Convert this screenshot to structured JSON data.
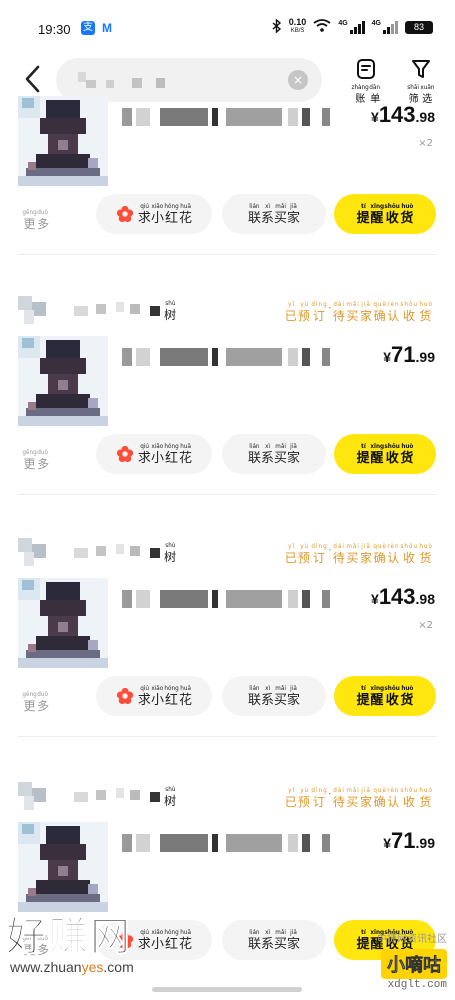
{
  "status_bar": {
    "time": "19:30",
    "net_speed": "0.10",
    "net_unit": "KB/S",
    "sig1": "4G",
    "sig2": "4G",
    "battery": "83"
  },
  "header": {
    "bill_py": [
      "zhàng",
      "dān"
    ],
    "bill_chars": [
      "账",
      "单"
    ],
    "filter_py": [
      "shāi",
      "xuǎn"
    ],
    "filter_chars": [
      "筛",
      "选"
    ]
  },
  "labels": {
    "more_py": [
      "gēng",
      "duō"
    ],
    "more_chars": [
      "更",
      "多"
    ],
    "flower_py": [
      "qiú",
      "xiǎo",
      "hóng",
      "huā"
    ],
    "flower_chars": [
      "求",
      "小",
      "红",
      "花"
    ],
    "contact_py": [
      "lián",
      "xì",
      "mǎi",
      "jiā"
    ],
    "contact_chars": [
      "联",
      "系",
      "买",
      "家"
    ],
    "remind_py": [
      "tí",
      "xǐng",
      "shōu",
      "huò"
    ],
    "remind_chars": [
      "提",
      "醒",
      "收",
      "货"
    ],
    "status_py": [
      "yǐ",
      "yù",
      "dìng",
      "",
      "dài",
      "mǎi",
      "jiā",
      "què",
      "rèn",
      "shōu",
      "huò"
    ],
    "status_chars": [
      "已",
      "预",
      "订",
      "·",
      "待",
      "买",
      "家",
      "确",
      "认",
      "收",
      "货"
    ],
    "shop_py": "shù",
    "shop_char": "树",
    "currency": "¥"
  },
  "orders": [
    {
      "price_int": "143",
      "price_dec": ".98",
      "qty": "×2"
    },
    {
      "price_int": "71",
      "price_dec": ".99"
    },
    {
      "price_int": "143",
      "price_dec": ".98",
      "qty": "×2"
    },
    {
      "price_int": "71",
      "price_dec": ".99"
    }
  ],
  "watermarks": {
    "left_big": "好赚网",
    "left_url_a": "www.zhuan",
    "left_url_b": "yes",
    "left_url_c": ".com",
    "right_top": "中捷网资讯社区",
    "right_box": "小嘀咕",
    "right_url": "xdglt.com"
  },
  "colors": {
    "accent": "#ffe60f",
    "status": "#e0982b",
    "flower": "#ff4d3a"
  }
}
